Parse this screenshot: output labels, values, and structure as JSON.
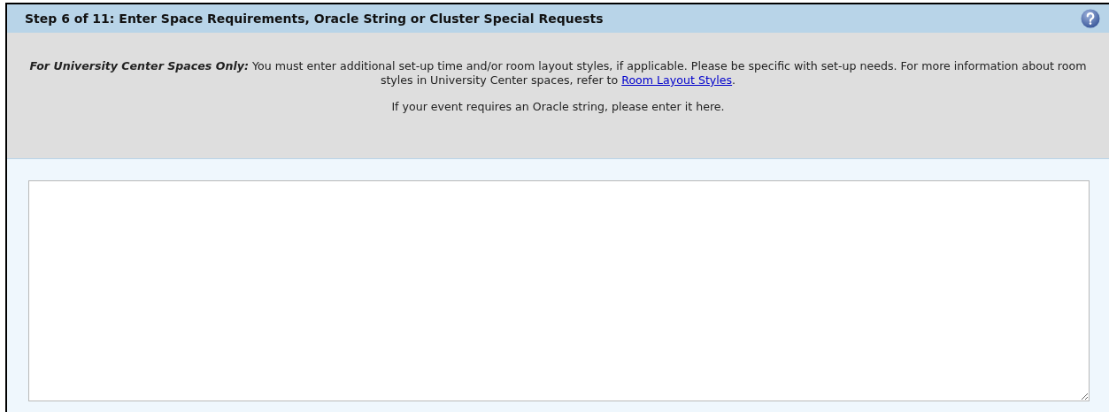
{
  "header": {
    "title": "Step 6 of 11: Enter Space Requirements, Oracle String or Cluster Special Requests"
  },
  "instructions": {
    "lead": "For University Center Spaces Only:",
    "text": " You must enter additional set-up time and/or room layout styles, if applicable. Please be specific with set-up needs. For more information about room styles in University Center spaces, refer to ",
    "link": "Room Layout Styles",
    "after": "."
  },
  "note": "If your event requires an Oracle string, please enter it here."
}
